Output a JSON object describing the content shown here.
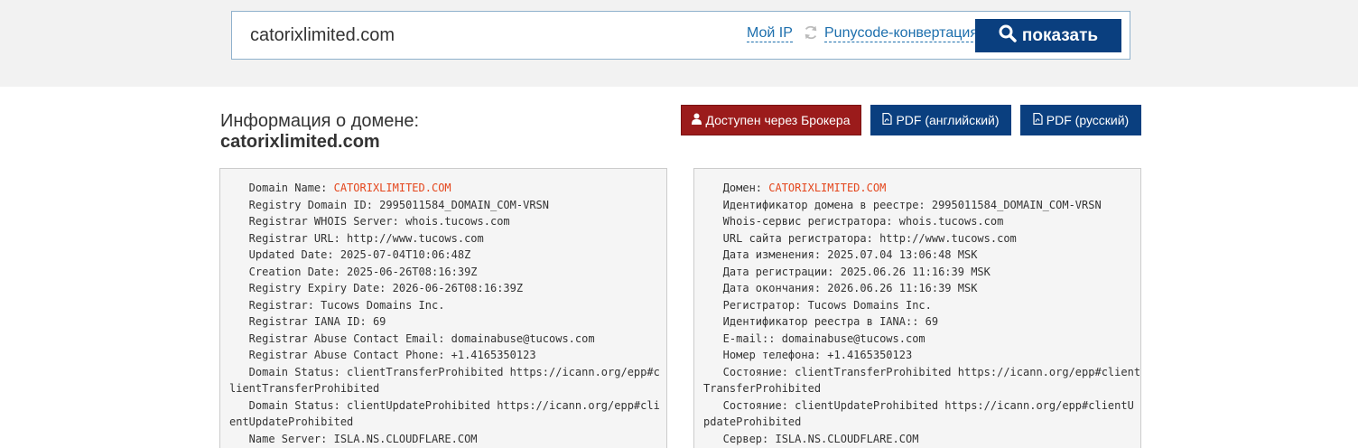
{
  "search": {
    "value": "catorixlimited.com",
    "my_ip_link": "Мой IP",
    "punycode_link": "Punycode-конвертация",
    "show_button": "показать"
  },
  "heading": {
    "title": "Информация о домене:",
    "domain": "catorixlimited.com"
  },
  "actions": {
    "broker": "Доступен через Брокера",
    "pdf_en": "PDF (английский)",
    "pdf_ru": "PDF (русский)"
  },
  "whois_en": {
    "lines": [
      {
        "label": "   Domain Name: ",
        "value": "CATORIXLIMITED.COM"
      },
      {
        "label": "   Registry Domain ID: 2995011584_DOMAIN_COM-VRSN",
        "value": ""
      },
      {
        "label": "   Registrar WHOIS Server: whois.tucows.com",
        "value": ""
      },
      {
        "label": "   Registrar URL: http://www.tucows.com",
        "value": ""
      },
      {
        "label": "   Updated Date: 2025-07-04T10:06:48Z",
        "value": ""
      },
      {
        "label": "   Creation Date: 2025-06-26T08:16:39Z",
        "value": ""
      },
      {
        "label": "   Registry Expiry Date: 2026-06-26T08:16:39Z",
        "value": ""
      },
      {
        "label": "   Registrar: Tucows Domains Inc.",
        "value": ""
      },
      {
        "label": "   Registrar IANA ID: 69",
        "value": ""
      },
      {
        "label": "   Registrar Abuse Contact Email: domainabuse@tucows.com",
        "value": ""
      },
      {
        "label": "   Registrar Abuse Contact Phone: +1.4165350123",
        "value": ""
      },
      {
        "label": "   Domain Status: clientTransferProhibited https://icann.org/epp#c",
        "value": ""
      },
      {
        "label": "lientTransferProhibited",
        "value": ""
      },
      {
        "label": "   Domain Status: clientUpdateProhibited https://icann.org/epp#cli",
        "value": ""
      },
      {
        "label": "entUpdateProhibited",
        "value": ""
      },
      {
        "label": "   Name Server: ISLA.NS.CLOUDFLARE.COM",
        "value": ""
      }
    ]
  },
  "whois_ru": {
    "lines": [
      {
        "label": "   Домен: ",
        "value": "CATORIXLIMITED.COM"
      },
      {
        "label": "   Идентификатор домена в реестре: 2995011584_DOMAIN_COM-VRSN",
        "value": ""
      },
      {
        "label": "   Whois-сервис регистратора: whois.tucows.com",
        "value": ""
      },
      {
        "label": "   URL сайта регистратора: http://www.tucows.com",
        "value": ""
      },
      {
        "label": "   Дата изменения: 2025.07.04 13:06:48 MSK",
        "value": ""
      },
      {
        "label": "   Дата регистрации: 2025.06.26 11:16:39 MSK",
        "value": ""
      },
      {
        "label": "   Дата окончания: 2026.06.26 11:16:39 MSK",
        "value": ""
      },
      {
        "label": "   Регистратор: Tucows Domains Inc.",
        "value": ""
      },
      {
        "label": "   Идентификатор реестра в IANA:: 69",
        "value": ""
      },
      {
        "label": "   E-mail:: domainabuse@tucows.com",
        "value": ""
      },
      {
        "label": "   Номер телефона: +1.4165350123",
        "value": ""
      },
      {
        "label": "   Состояние: clientTransferProhibited https://icann.org/epp#client",
        "value": ""
      },
      {
        "label": "TransferProhibited",
        "value": ""
      },
      {
        "label": "   Состояние: clientUpdateProhibited https://icann.org/epp#clientU",
        "value": ""
      },
      {
        "label": "pdateProhibited",
        "value": ""
      },
      {
        "label": "   Сервер: ISLA.NS.CLOUDFLARE.COM",
        "value": ""
      }
    ]
  },
  "colors": {
    "primary": "#0a3f7f",
    "broker": "#9b1b1b",
    "link": "#1d6fad",
    "highlight": "#e4461c"
  }
}
